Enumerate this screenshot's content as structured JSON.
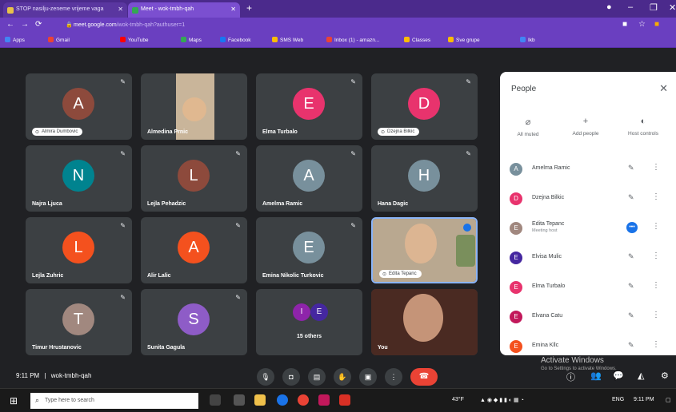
{
  "browser": {
    "tabs": [
      {
        "label": "STOP nasilju-zeneme vrijeme vaga",
        "active": false
      },
      {
        "label": "Meet - wok-tmbh-qah",
        "active": true
      }
    ],
    "url_host": "meet.google.com",
    "url_path": "/wok-tmbh-qah?authuser=1",
    "bookmarks": [
      "Apps",
      "Gmail",
      "YouTube",
      "Maps",
      "Facebook",
      "SMS Web",
      "Inbox (1) - amazn...",
      "Classes",
      "Sve grupe",
      "Ikb"
    ]
  },
  "tiles": [
    {
      "name": "Almira Dumbovic",
      "initial": "A",
      "color": "#8d4a3c",
      "style": "pill"
    },
    {
      "name": "Almedina Prnic",
      "initial": "",
      "color": "",
      "style": "video"
    },
    {
      "name": "Elma Turbalo",
      "initial": "E",
      "color": "#e8336d",
      "style": "label"
    },
    {
      "name": "Dzejna Bilkic",
      "initial": "D",
      "color": "#e8336d",
      "style": "pill"
    },
    {
      "name": "Najra Ljuca",
      "initial": "N",
      "color": "#00838f",
      "style": "label"
    },
    {
      "name": "Lejla Pehadzic",
      "initial": "L",
      "color": "#8d4a3c",
      "style": "label"
    },
    {
      "name": "Amelma Ramic",
      "initial": "A",
      "color": "#78909c",
      "style": "label"
    },
    {
      "name": "Hana Dagic",
      "initial": "H",
      "color": "#78909c",
      "style": "label"
    },
    {
      "name": "Lejla Zuhric",
      "initial": "L",
      "color": "#f4511e",
      "style": "label"
    },
    {
      "name": "Alir Lalic",
      "initial": "A",
      "color": "#f4511e",
      "style": "label"
    },
    {
      "name": "Emina Nikolic Turkovic",
      "initial": "E",
      "color": "#78909c",
      "style": "label"
    },
    {
      "name": "Edita Tepanc",
      "initial": "",
      "color": "",
      "style": "video-pill"
    },
    {
      "name": "Timur Hrustanovic",
      "initial": "T",
      "color": "#a1887f",
      "style": "label"
    },
    {
      "name": "Sunita Gagula",
      "initial": "S",
      "color": "#8e5cc7",
      "style": "label"
    },
    {
      "name": "15 others",
      "initial": "",
      "color": "",
      "style": "others"
    },
    {
      "name": "You",
      "initial": "",
      "color": "",
      "style": "video-self"
    }
  ],
  "others_avatars": [
    "I",
    "E"
  ],
  "panel": {
    "title": "People",
    "actions": [
      {
        "label": "All muted",
        "icon": "mic-off-icon",
        "glyph": "⌀"
      },
      {
        "label": "Add people",
        "icon": "person-add-icon",
        "glyph": "+"
      },
      {
        "label": "Host controls",
        "icon": "shield-icon",
        "glyph": "◐"
      }
    ],
    "people": [
      {
        "name": "Amelma Ramic",
        "sub": "",
        "initial": "A",
        "color": "#78909c",
        "speaking": false
      },
      {
        "name": "Dzejna Bilkic",
        "sub": "",
        "initial": "D",
        "color": "#e8336d",
        "speaking": false
      },
      {
        "name": "Edita Tepanc",
        "sub": "Meeting host",
        "initial": "E",
        "color": "#a1887f",
        "speaking": true
      },
      {
        "name": "Elvisa Mulic",
        "sub": "",
        "initial": "E",
        "color": "#4527a0",
        "speaking": false
      },
      {
        "name": "Elma Turbalo",
        "sub": "",
        "initial": "E",
        "color": "#e8336d",
        "speaking": false
      },
      {
        "name": "Elvana Catu",
        "sub": "",
        "initial": "E",
        "color": "#c2185b",
        "speaking": false
      },
      {
        "name": "Emina Kllc",
        "sub": "",
        "initial": "E",
        "color": "#f4511e",
        "speaking": false
      }
    ]
  },
  "bottom": {
    "clock": "9:11 PM",
    "meeting_code": "wok-tmbh-qah",
    "activate_title": "Activate Windows",
    "activate_sub": "Go to Settings to activate Windows."
  },
  "taskbar": {
    "search_placeholder": "Type here to search",
    "weather": "43°F",
    "lang": "ENG",
    "time": "9:11 PM"
  }
}
